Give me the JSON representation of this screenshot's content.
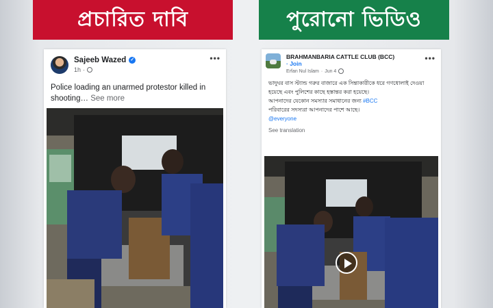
{
  "left_panel": {
    "banner": "প্রচারিত দাবি",
    "banner_color": "#c8102e",
    "post": {
      "author": "Sajeeb Wazed",
      "verified": true,
      "time": "1h",
      "more_icon": "more-horizontal-icon",
      "text": "Police loading an unarmed protestor killed in shooting…",
      "see_more": "See more"
    }
  },
  "right_panel": {
    "banner": "পুরোনো ভিডিও",
    "banner_color": "#16814a",
    "post": {
      "page_name": "BRAHMANBARIA CATTLE CLUB (BCC)",
      "join": "· Join",
      "author": "Erfan Nul Islam",
      "time": "Jun 4",
      "more_icon": "more-horizontal-icon",
      "text": "ভাদুঘর বাস স্ট্যান্ড গরুর বাজারে এক সিন্তাকারীকে ধরে গণধোলাই দেওয়া হয়েছে এবং পুলিশের কাছে হস্তান্তর করা হয়েছে।",
      "text2": "আপনাদের যেকোন সমস্যার সমাধানের জন্য",
      "hashtag": "#BCC",
      "text3": "পরিবারের সদস্যরা আপনাদের পাশে আছে।",
      "mention": "@everyone",
      "see_translation": "See translation",
      "play_icon": "play-icon"
    }
  }
}
